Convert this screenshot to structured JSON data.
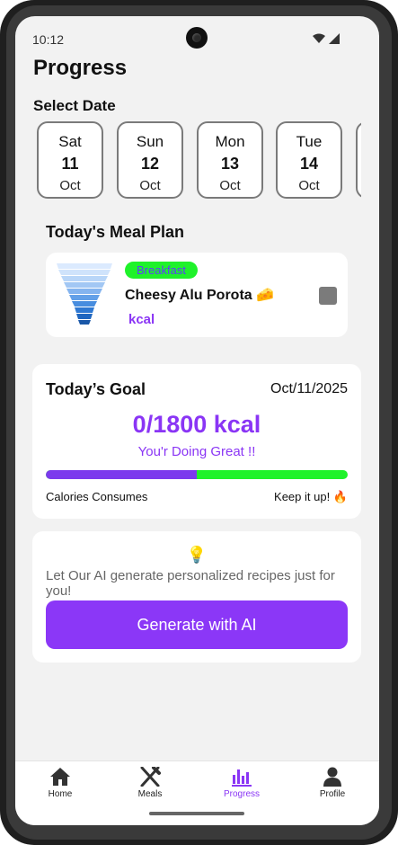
{
  "status_bar": {
    "time": "10:12"
  },
  "page": {
    "title": "Progress"
  },
  "date_picker": {
    "label": "Select Date",
    "dates": [
      {
        "dow": "Sat",
        "day": "11",
        "month": "Oct"
      },
      {
        "dow": "Sun",
        "day": "12",
        "month": "Oct"
      },
      {
        "dow": "Mon",
        "day": "13",
        "month": "Oct"
      },
      {
        "dow": "Tue",
        "day": "14",
        "month": "Oct"
      }
    ]
  },
  "meal_plan": {
    "title": "Today's Meal Plan",
    "meal": {
      "badge": "Breakfast",
      "name": "Cheesy Alu Porota 🧀",
      "kcal": "kcal"
    }
  },
  "goal": {
    "title": "Today’s Goal",
    "date": "Oct/11/2025",
    "calories": "0/1800 kcal",
    "message": "You'r Doing Great !!",
    "progress_fraction": 0.5,
    "left_label": "Calories Consumes",
    "right_label": "Keep it up! 🔥"
  },
  "ai": {
    "icon": "lightbulb-icon",
    "emoji": "💡",
    "text": "Let Our AI generate personalized recipes just for you!",
    "button_label": "Generate with AI"
  },
  "tabs": [
    {
      "label": "Home",
      "icon": "home-icon",
      "active": false
    },
    {
      "label": "Meals",
      "icon": "utensils-icon",
      "active": false
    },
    {
      "label": "Progress",
      "icon": "bar-chart-icon",
      "active": true
    },
    {
      "label": "Profile",
      "icon": "person-icon",
      "active": false
    }
  ],
  "colors": {
    "accent": "#8a35f5",
    "progress_track": "#1ff22a",
    "badge_bg": "#1ff22a"
  }
}
